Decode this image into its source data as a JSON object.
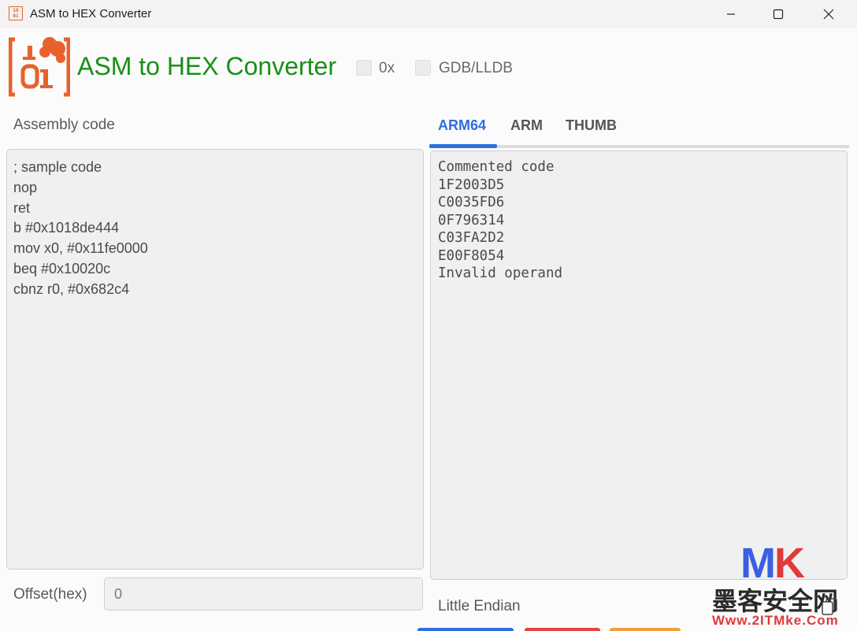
{
  "window": {
    "icon_text": "[10\n01]",
    "title": "ASM to HEX Converter"
  },
  "header": {
    "app_title": "ASM to HEX Converter",
    "option_0x_label": "0x",
    "option_0x_checked": false,
    "option_gdb_label": "GDB/LLDB",
    "option_gdb_checked": false
  },
  "left": {
    "assembly_label": "Assembly code",
    "assembly_lines": [
      "; sample code",
      "nop",
      "ret",
      "b #0x1018de444",
      "mov x0, #0x11fe0000",
      "beq #0x10020c",
      "cbnz r0, #0x682c4"
    ],
    "offset_label": "Offset(hex)",
    "offset_value": "0"
  },
  "right": {
    "tabs": [
      {
        "label": "ARM64",
        "active": true
      },
      {
        "label": "ARM",
        "active": false
      },
      {
        "label": "THUMB",
        "active": false
      }
    ],
    "hex_lines": [
      "Commented code",
      "1F2003D5",
      "C0035FD6",
      "0F796314",
      "C03FA2D2",
      "E00F8054",
      "Invalid operand"
    ],
    "endian_label": "Little Endian"
  },
  "watermark": {
    "mk_m": "M",
    "mk_k": "K",
    "cn": "墨客安全网",
    "url": "Www.2ITMke.Com"
  },
  "colors": {
    "accent": "#2f6fe0",
    "title_green": "#1a8f1a",
    "logo_orange": "#e8612c"
  }
}
